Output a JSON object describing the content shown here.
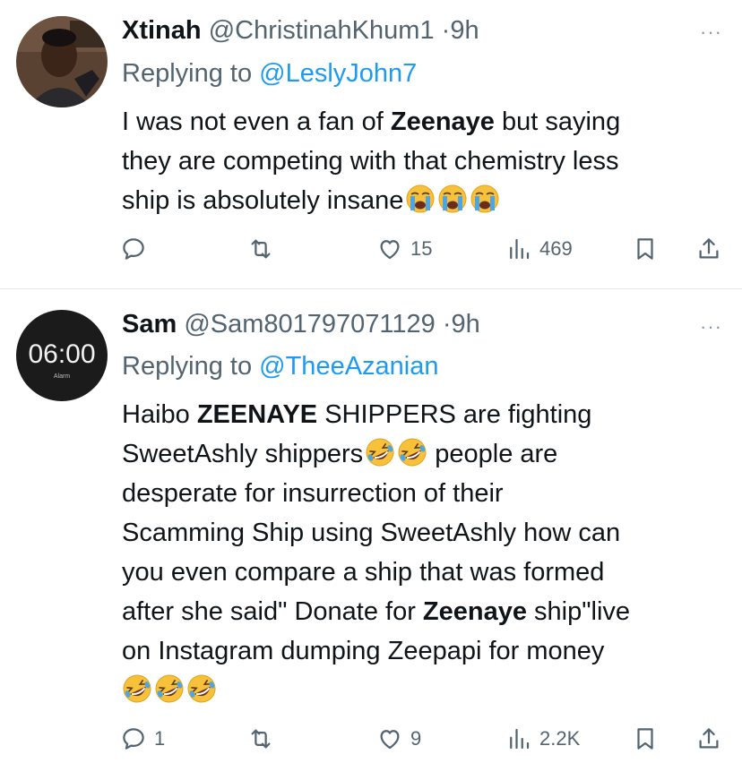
{
  "tweets": [
    {
      "name": "Xtinah",
      "handle": "@ChristinahKhum1",
      "separator": "·",
      "time": "9h",
      "replying_prefix": "Replying to ",
      "replying_to": "@LeslyJohn7",
      "body": {
        "line1_a": "I was not even a  fan of ",
        "line1_bold": "Zeenaye",
        "line1_b": " but saying",
        "line2": "they are competing with that chemistry less",
        "line3": "ship is absolutely insane"
      },
      "emojis": [
        "loudly-crying-face",
        "loudly-crying-face",
        "loudly-crying-face"
      ],
      "stats": {
        "replies": "",
        "retweets": "",
        "likes": "15",
        "views": "469"
      }
    },
    {
      "name": "Sam",
      "handle": "@Sam801797071129",
      "separator": "·",
      "time": "9h",
      "avatar_text": "06:00",
      "avatar_subtext": "Alarm",
      "replying_prefix": "Replying to ",
      "replying_to": "@TheeAzanian",
      "body": {
        "l1_a": "Haibo ",
        "l1_bold": "ZEENAYE",
        "l1_b": " SHIPPERS are fighting",
        "l2_a": "SweetAshly shippers",
        "l2_b": " people are",
        "l3": "desperate for insurrection of their",
        "l4": "Scamming Ship using SweetAshly how can",
        "l5": "you even compare a ship that was formed",
        "l6_a": "after she said\" Donate for ",
        "l6_bold": "Zeenaye",
        "l6_b": " ship\"live",
        "l7": "on Instagram dumping Zeepapi for money"
      },
      "emojis": [
        "rolling-on-floor-laughing",
        "rolling-on-floor-laughing",
        "rolling-on-floor-laughing",
        "rolling-on-floor-laughing",
        "rolling-on-floor-laughing"
      ],
      "stats": {
        "replies": "1",
        "retweets": "",
        "likes": "9",
        "views": "2.2K"
      }
    }
  ],
  "more_label": "···",
  "colors": {
    "text": "#0f1419",
    "secondary": "#536471",
    "link": "#1d9bf0",
    "divider": "#e1e6ea"
  }
}
